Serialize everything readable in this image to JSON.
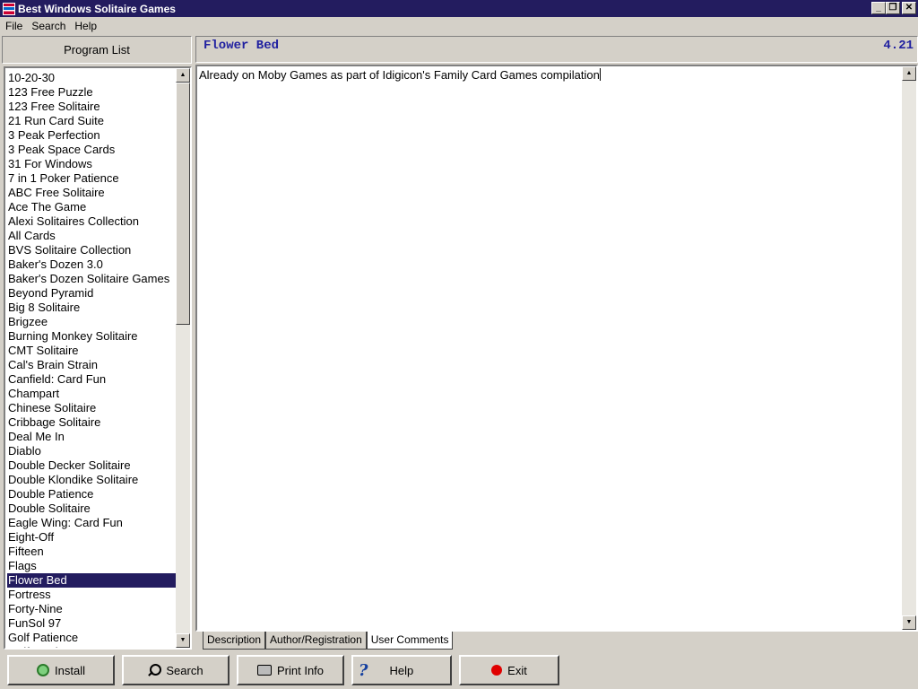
{
  "window": {
    "title": "Best Windows Solitaire Games"
  },
  "menu": [
    "File",
    "Search",
    "Help"
  ],
  "program_list": {
    "header": "Program List",
    "items": [
      "10-20-30",
      "123 Free Puzzle",
      "123 Free Solitaire",
      "21 Run Card Suite",
      "3 Peak Perfection",
      "3 Peak Space Cards",
      "31 For Windows",
      "7 in 1 Poker Patience",
      "ABC Free Solitaire",
      "Ace The Game",
      "Alexi Solitaires Collection",
      "All Cards",
      "BVS Solitaire Collection",
      "Baker's Dozen 3.0",
      "Baker's Dozen Solitaire Games",
      "Beyond Pyramid",
      "Big 8 Solitaire",
      "Brigzee",
      "Burning Monkey Solitaire",
      "CMT Solitaire",
      "Cal's Brain Strain",
      "Canfield: Card Fun",
      "Champart",
      "Chinese Solitaire",
      "Cribbage Solitaire",
      "Deal Me In",
      "Diablo",
      "Double Decker Solitaire",
      "Double Klondike Solitaire",
      "Double Patience",
      "Double Solitaire",
      "Eagle Wing: Card Fun",
      "Eight-Off",
      "Fifteen",
      "Flags",
      "Flower Bed",
      "Fortress",
      "Forty-Nine",
      "FunSol 97",
      "Golf Patience",
      "Golf Card Fun"
    ],
    "selected": "Flower Bed"
  },
  "details": {
    "title": "Flower Bed",
    "rating": "4.21",
    "description": "Already on Moby Games as part of Idigicon's Family Card Games compilation"
  },
  "tabs": [
    "Description",
    "Author/Registration",
    "User Comments"
  ],
  "active_tab": "User Comments",
  "buttons": {
    "install": "Install",
    "search": "Search",
    "print_info": "Print Info",
    "help": "Help",
    "exit": "Exit"
  },
  "colors": {
    "titlebar": "#231c5f",
    "selection": "#231c5f",
    "header_text": "#2020a0"
  }
}
